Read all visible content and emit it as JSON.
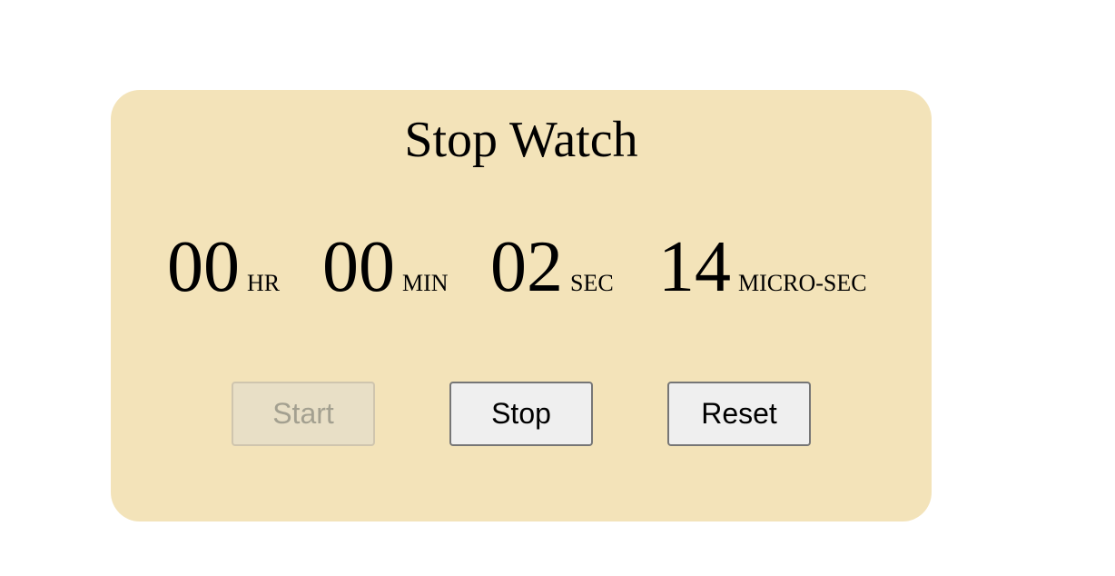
{
  "title": "Stop Watch",
  "display": {
    "hours": {
      "value": "00",
      "unit": "HR"
    },
    "minutes": {
      "value": "00",
      "unit": "MIN"
    },
    "seconds": {
      "value": "02",
      "unit": "SEC"
    },
    "micro": {
      "value": "14",
      "unit": "MICRO-SEC"
    }
  },
  "buttons": {
    "start": {
      "label": "Start",
      "disabled": true
    },
    "stop": {
      "label": "Stop"
    },
    "reset": {
      "label": "Reset"
    }
  },
  "colors": {
    "card_background": "#f3e3b9",
    "page_background": "#ffffff"
  }
}
